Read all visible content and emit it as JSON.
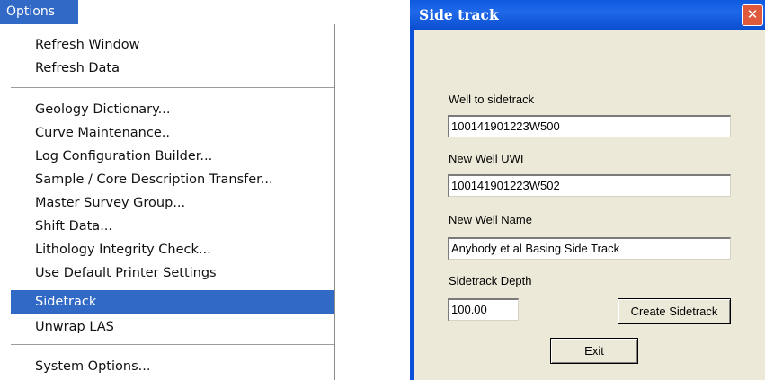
{
  "menu": {
    "title": "Options",
    "groups": [
      [
        "Refresh Window",
        "Refresh Data"
      ],
      [
        "Geology Dictionary...",
        "Curve Maintenance..",
        "Log Configuration Builder...",
        "Sample / Core Description Transfer...",
        "Master Survey Group...",
        "Shift Data...",
        "Lithology Integrity Check...",
        "Use Default Printer Settings",
        "Sidetrack",
        "Unwrap LAS"
      ],
      [
        "System Options..."
      ]
    ],
    "selected": "Sidetrack",
    "selection_color": "#3169c6"
  },
  "dialog": {
    "title": "Side track",
    "close_icon": "close-icon",
    "fields": {
      "well_to_sidetrack": {
        "label": "Well to sidetrack",
        "value": "100141901223W500"
      },
      "new_well_uwi": {
        "label": "New Well UWI",
        "value": "100141901223W502"
      },
      "new_well_name": {
        "label": "New Well Name",
        "value": "Anybody et al Basing Side Track"
      },
      "sidetrack_depth": {
        "label": "Sidetrack Depth",
        "value": "100.00"
      }
    },
    "create_button": "Create Sidetrack",
    "exit_button": "Exit",
    "colors": {
      "titlebar": "#0b50d8",
      "client": "#ece9d8",
      "close": "#e0593b"
    }
  }
}
